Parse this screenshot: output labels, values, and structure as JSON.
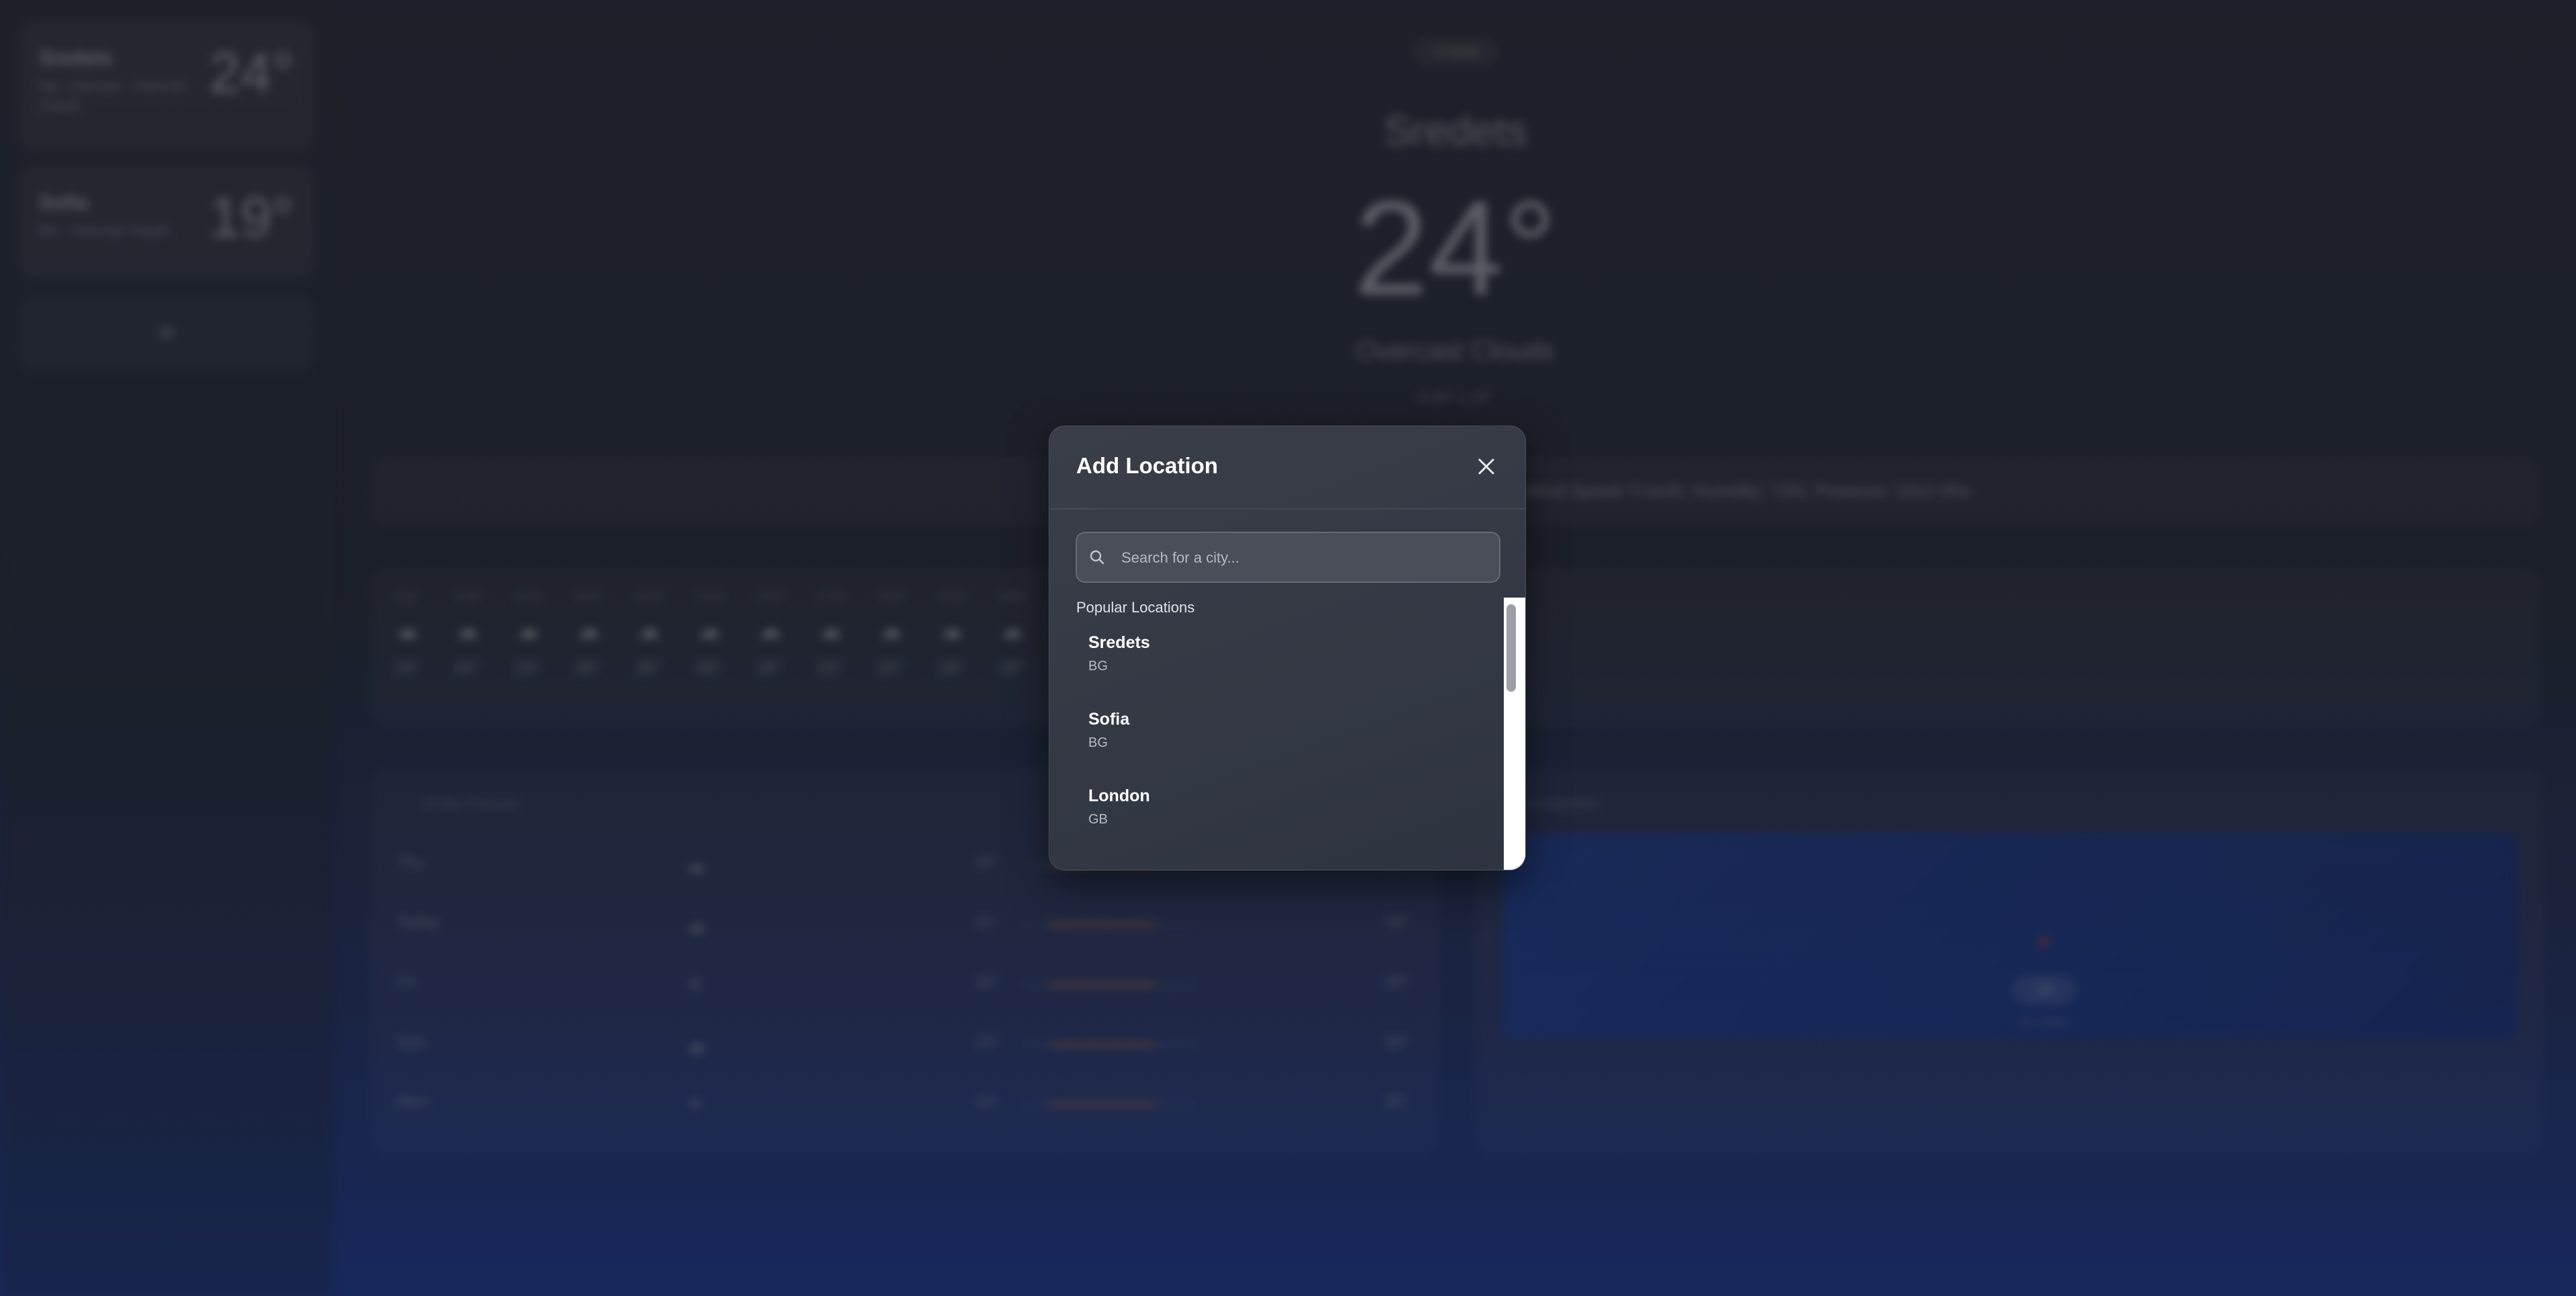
{
  "sidebar": {
    "locations": [
      {
        "name": "Sredets",
        "desc": "Mix, Overcast · Overcast Clouds",
        "time": "Now 4:50",
        "temp": "24°"
      },
      {
        "name": "Sofia",
        "desc": "BG · Overcast Clouds",
        "time": "4:50 · 19",
        "temp": "19°"
      }
    ],
    "add_label": "+"
  },
  "hero": {
    "badge": "☀ Good",
    "city": "Sredets",
    "temp": "24°",
    "condition": "Overcast Clouds",
    "high_low": "H:24° L:24°"
  },
  "summary": "Wind Speed: 5 km/h, Humidity: 72%, Pressure: 1012 hPa",
  "hourly": [
    {
      "t": "Now",
      "v": "24°"
    },
    {
      "t": "11:00",
      "v": "24°"
    },
    {
      "t": "12:00",
      "v": "23°"
    },
    {
      "t": "13:00",
      "v": "26°"
    },
    {
      "t": "14:00",
      "v": "26°"
    },
    {
      "t": "15:00",
      "v": "26°"
    },
    {
      "t": "16:00",
      "v": "26°"
    },
    {
      "t": "17:00",
      "v": "23°"
    },
    {
      "t": "18:00",
      "v": "23°"
    },
    {
      "t": "19:00",
      "v": "19°"
    },
    {
      "t": "20:00",
      "v": "18°"
    }
  ],
  "daily": {
    "title": "10-Day Forecast",
    "days": [
      {
        "d": "Thu",
        "lo": "24°",
        "hi": "24°",
        "icon": "☁"
      },
      {
        "d": "Today",
        "lo": "21°",
        "hi": "29°",
        "icon": "☁"
      },
      {
        "d": "Fri",
        "lo": "15°",
        "hi": "30°",
        "icon": "☀"
      },
      {
        "d": "Sun",
        "lo": "14°",
        "hi": "30°",
        "icon": "☁"
      },
      {
        "d": "Mon",
        "lo": "13°",
        "hi": "30°",
        "icon": "☀"
      }
    ]
  },
  "map": {
    "title": "Precipitation",
    "marker_label": "24",
    "marker_sub": "My Location"
  },
  "modal": {
    "title": "Add Location",
    "search_placeholder": "Search for a city...",
    "section_label": "Popular Locations",
    "items": [
      {
        "city": "Sredets",
        "country": "BG"
      },
      {
        "city": "Sofia",
        "country": "BG"
      },
      {
        "city": "London",
        "country": "GB"
      }
    ]
  },
  "colors": {
    "accent": "#c8703a",
    "modal_bg": "#363a45",
    "page_bottom": "#1a327f"
  }
}
